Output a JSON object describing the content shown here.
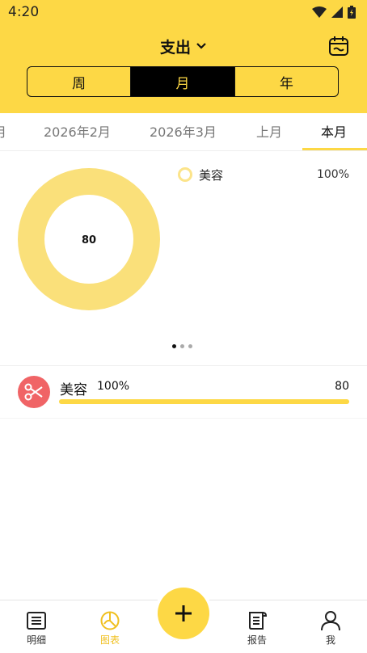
{
  "status_bar": {
    "time": "4:20"
  },
  "header": {
    "title": "支出",
    "segments": [
      "周",
      "月",
      "年"
    ],
    "active_segment": "月"
  },
  "period_tabs": [
    "月",
    "2026年2月",
    "2026年3月",
    "上月",
    "本月"
  ],
  "active_period": "本月",
  "chart_data": {
    "type": "pie",
    "style": "donut",
    "center_label": "80",
    "categories": [
      "美容"
    ],
    "values": [
      80
    ],
    "percentages": [
      "100%"
    ],
    "colors": [
      "#fae07a"
    ]
  },
  "legend": [
    {
      "name": "美容",
      "percent": "100%"
    }
  ],
  "category_list": [
    {
      "name": "美容",
      "percent": "100%",
      "amount": "80",
      "progress": 1.0,
      "icon": "scissors-icon",
      "icon_color": "#f06466"
    }
  ],
  "bottom_nav": {
    "items": [
      {
        "label": "明细",
        "icon": "list-icon"
      },
      {
        "label": "图表",
        "icon": "pie-chart-icon"
      },
      {
        "label": "报告",
        "icon": "report-icon"
      },
      {
        "label": "我",
        "icon": "person-icon"
      }
    ],
    "active": "图表",
    "fab_icon": "plus-icon"
  },
  "colors": {
    "accent": "#fdd845",
    "active_segment_bg": "#000000"
  }
}
